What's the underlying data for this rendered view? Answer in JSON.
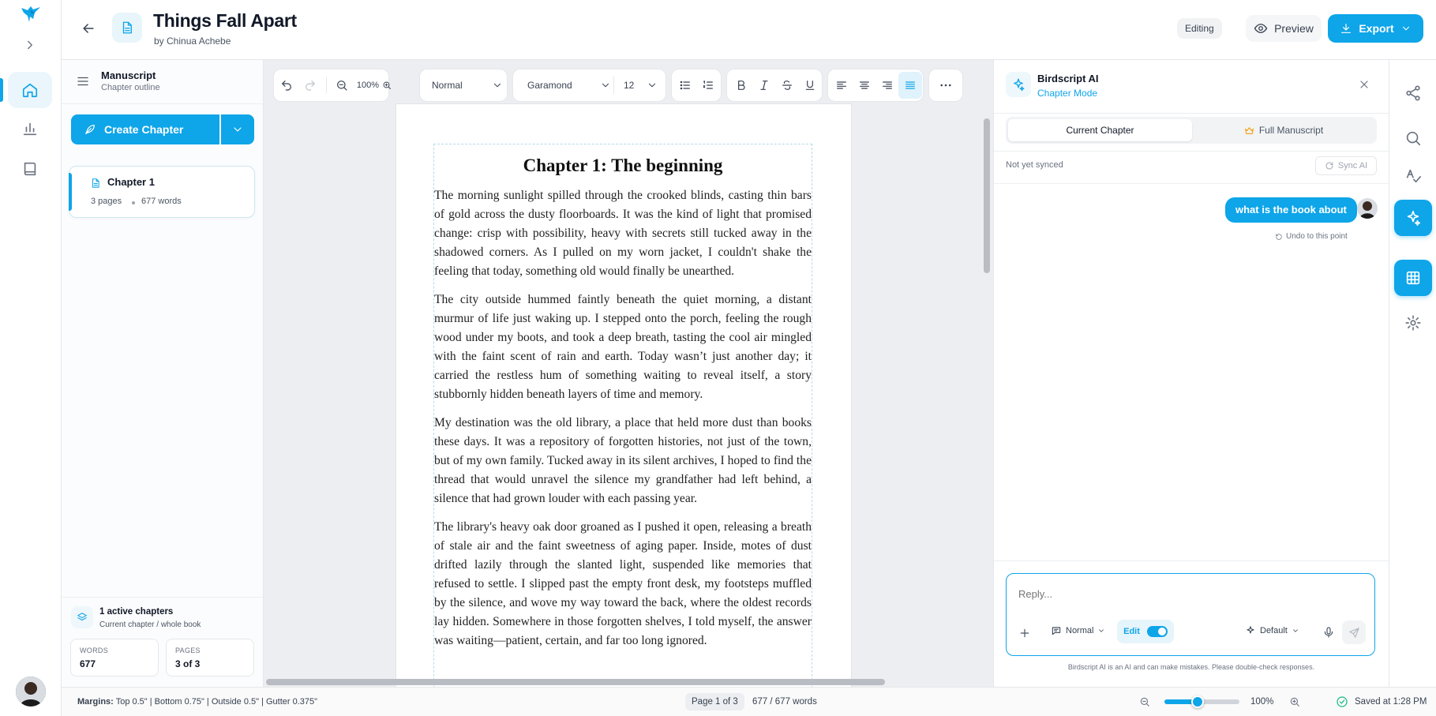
{
  "header": {
    "title": "Things Fall Apart",
    "author": "by Chinua Achebe",
    "editing_badge": "Editing",
    "preview_label": "Preview",
    "export_label": "Export"
  },
  "sidebar": {
    "title": "Manuscript",
    "subtitle": "Chapter outline",
    "create_chapter": "Create Chapter",
    "chapters": [
      {
        "title": "Chapter 1",
        "pages": "3 pages",
        "words": "677 words"
      }
    ],
    "footer": {
      "active_title": "1 active chapters",
      "active_sub": "Current chapter / whole book",
      "words_label": "WORDS",
      "words_value": "677",
      "pages_label": "PAGES",
      "pages_value": "3 of 3"
    }
  },
  "toolbar": {
    "zoom": "100%",
    "style": "Normal",
    "font": "Garamond",
    "size": "12"
  },
  "document": {
    "heading": "Chapter 1: The beginning",
    "paragraphs": [
      "The morning sunlight spilled through the crooked blinds, casting thin bars of gold across the dusty floorboards. It was the kind of light that promised change: crisp with possibility, heavy with secrets still tucked away in the shadowed corners. As I pulled on my worn jacket, I couldn't shake the feeling that today, something old would finally be unearthed.",
      "The city outside hummed faintly beneath the quiet morning, a distant murmur of life just waking up. I stepped onto the porch, feeling the rough wood under my boots, and took a deep breath, tasting the cool air mingled with the faint scent of rain and earth. Today wasn’t just another day; it carried the restless hum of something waiting to reveal itself, a story stubbornly hidden beneath layers of time and memory.",
      "My destination was the old library, a place that held more dust than books these days. It was a repository of forgotten histories, not just of the town, but of my own family. Tucked away in its silent archives, I hoped to find the thread that would unravel the silence my grandfather had left behind, a silence that had grown louder with each passing year.",
      "The library's heavy oak door groaned as I pushed it open, releasing a breath of stale air and the faint sweetness of aging paper. Inside, motes of dust drifted lazily through the slanted light, suspended like memories that refused to settle. I slipped past the empty front desk, my footsteps muffled by the silence, and wove my way toward the back, where the oldest records lay hidden. Somewhere in those forgotten shelves, I told myself, the answer was waiting—patient, certain, and far too long ignored."
    ]
  },
  "ai": {
    "title": "Birdscript AI",
    "mode": "Chapter Mode",
    "tab_current": "Current Chapter",
    "tab_full": "Full Manuscript",
    "sync_status": "Not yet synced",
    "sync_button": "Sync AI",
    "user_message": "what is the book about",
    "undo": "Undo to this point",
    "reply_placeholder": "Reply...",
    "style_select": "Normal",
    "edit_label": "Edit",
    "model_select": "Default",
    "disclaimer": "Birdscript AI is an AI and can make mistakes. Please double-check responses."
  },
  "status": {
    "margins_label": "Margins:",
    "margins_value": "Top 0.5\" | Bottom 0.75\" | Outside 0.5\" | Gutter 0.375\"",
    "page": "Page 1 of 3",
    "words": "677 / 677 words",
    "zoom": "100%",
    "zoom_level": 0.44,
    "saved": "Saved at 1:28 PM"
  },
  "colors": {
    "accent": "#0ea5e9",
    "accent_light": "#eaf6fc"
  }
}
